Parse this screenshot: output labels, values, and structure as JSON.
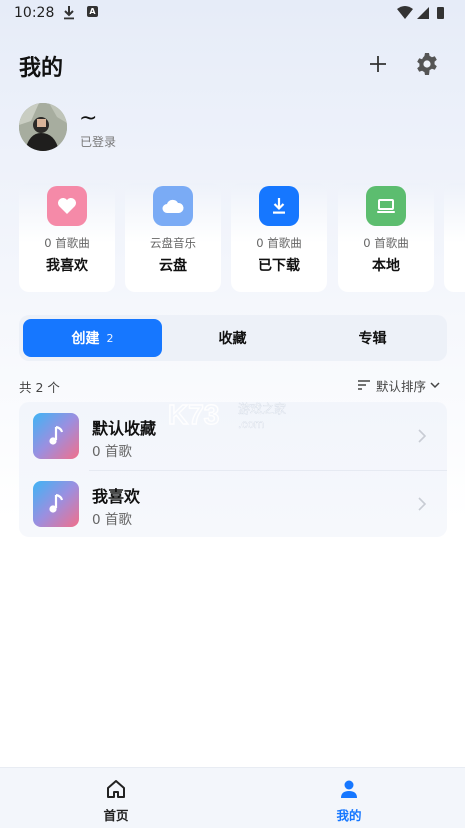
{
  "status_bar": {
    "time": "10:28",
    "notif_badge": "A"
  },
  "header": {
    "title": "我的",
    "add_icon": "plus-icon",
    "settings_icon": "gear-icon"
  },
  "user": {
    "name": "~",
    "status": "已登录"
  },
  "quick_cards": [
    {
      "icon": "heart-icon",
      "color": "#f58aa8",
      "sub": "0 首歌曲",
      "title": "我喜欢"
    },
    {
      "icon": "cloud-icon",
      "color": "#7aabf5",
      "sub": "云盘音乐",
      "title": "云盘"
    },
    {
      "icon": "download-icon",
      "color": "#1677ff",
      "sub": "0 首歌曲",
      "title": "已下载"
    },
    {
      "icon": "laptop-icon",
      "color": "#5cbd6f",
      "sub": "0 首歌曲",
      "title": "本地"
    }
  ],
  "tabs": {
    "created": {
      "label": "创建",
      "count": "2",
      "active": true
    },
    "favorites": {
      "label": "收藏"
    },
    "albums": {
      "label": "专辑"
    }
  },
  "list": {
    "count_label": "共 2 个",
    "sort_label": "默认排序",
    "playlists": [
      {
        "name": "默认收藏",
        "count": "0 首歌"
      },
      {
        "name": "我喜欢",
        "count": "0 首歌"
      }
    ]
  },
  "watermark": {
    "brand": "K73",
    "cn": "游戏之家",
    "domain": ".com"
  },
  "bottom_nav": {
    "home": {
      "label": "首页",
      "icon": "home-icon"
    },
    "mine": {
      "label": "我的",
      "icon": "person-icon",
      "active": true
    }
  },
  "colors": {
    "accent": "#1677ff",
    "heart": "#f58aa8",
    "cloud": "#7aabf5",
    "local": "#5cbd6f"
  }
}
